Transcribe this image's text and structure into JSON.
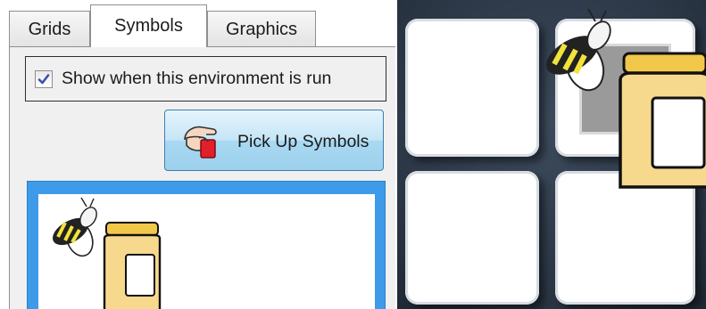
{
  "tabs": [
    {
      "label": "Grids",
      "active": false
    },
    {
      "label": "Symbols",
      "active": true
    },
    {
      "label": "Graphics",
      "active": false
    }
  ],
  "show_when_run": {
    "label": "Show when this environment is run",
    "checked": true
  },
  "pick_up_button": {
    "label": "Pick Up Symbols",
    "icon": "hand-pickup-icon"
  },
  "preview": {
    "symbols": [
      "bee-icon",
      "honey-jar-icon"
    ]
  },
  "grid": {
    "cells": 4,
    "dragged_symbols": [
      "bee-icon",
      "honey-jar-icon"
    ]
  },
  "colors": {
    "selection_blue": "#3d9be9",
    "button_blue": "#a9d9f2",
    "grid_background": "#2b3645",
    "jar_yellow": "#f7d98e",
    "bee_yellow": "#f2e33a"
  }
}
